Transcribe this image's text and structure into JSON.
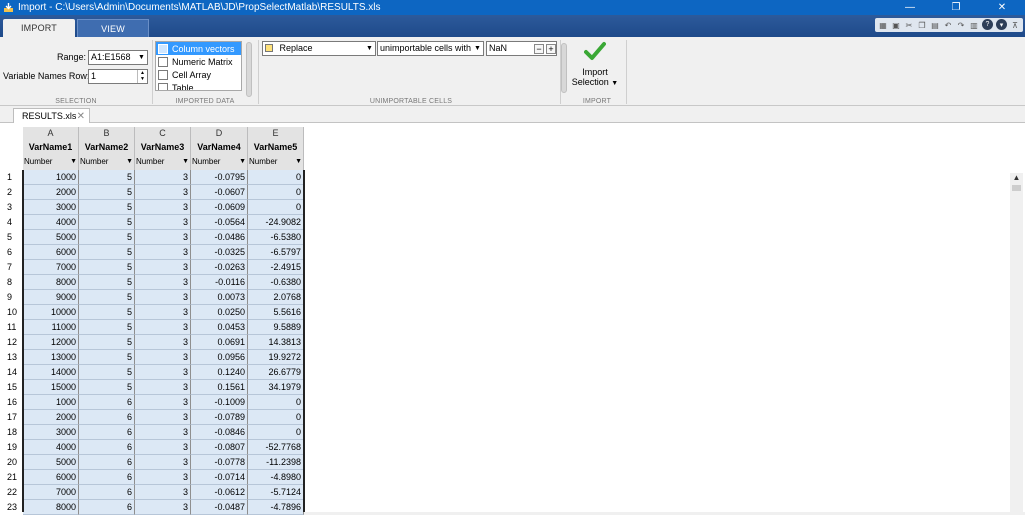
{
  "window": {
    "title": "Import - C:\\Users\\Admin\\Documents\\MATLAB\\JD\\PropSelectMatlab\\RESULTS.xls",
    "minimize": "—",
    "restore": "❐",
    "close": "✕"
  },
  "tabs": [
    {
      "label": "IMPORT",
      "active": true
    },
    {
      "label": "VIEW",
      "active": false
    }
  ],
  "quick_access_icons": [
    "mini-toolstrip-icon",
    "save-icon",
    "cut-icon",
    "copy-icon",
    "paste-icon",
    "undo-icon",
    "redo-icon",
    "switch-windows-icon",
    "help-icon",
    "search-icon",
    "collapse-icon"
  ],
  "selection": {
    "range_label": "Range:",
    "range_value": "A1:E1568",
    "varnames_label": "Variable Names Row:",
    "varnames_value": "1",
    "section_label": "SELECTION"
  },
  "imported_data": {
    "types": [
      {
        "label": "Column vectors",
        "icon": "column-vectors-icon",
        "selected": true
      },
      {
        "label": "Numeric Matrix",
        "icon": "numeric-matrix-icon",
        "selected": false
      },
      {
        "label": "Cell Array",
        "icon": "cell-array-icon",
        "selected": false
      },
      {
        "label": "Table",
        "icon": "table-icon",
        "selected": false
      }
    ],
    "section_label": "IMPORTED DATA"
  },
  "unimportable": {
    "rule": "Replace",
    "condition": "unimportable cells with",
    "value": "NaN",
    "remove": "−",
    "add": "+",
    "section_label": "UNIMPORTABLE CELLS"
  },
  "import": {
    "button_line1": "Import",
    "button_line2": "Selection",
    "section_label": "IMPORT"
  },
  "document_tab": {
    "label": "RESULTS.xls",
    "close": "✕"
  },
  "columns": [
    {
      "letter": "A",
      "name": "VarName1",
      "type": "Number"
    },
    {
      "letter": "B",
      "name": "VarName2",
      "type": "Number"
    },
    {
      "letter": "C",
      "name": "VarName3",
      "type": "Number"
    },
    {
      "letter": "D",
      "name": "VarName4",
      "type": "Number"
    },
    {
      "letter": "E",
      "name": "VarName5",
      "type": "Number"
    }
  ],
  "rows": [
    {
      "n": "1",
      "cells": [
        "1000",
        "5",
        "3",
        "-0.0795",
        "0"
      ]
    },
    {
      "n": "2",
      "cells": [
        "2000",
        "5",
        "3",
        "-0.0607",
        "0"
      ]
    },
    {
      "n": "3",
      "cells": [
        "3000",
        "5",
        "3",
        "-0.0609",
        "0"
      ]
    },
    {
      "n": "4",
      "cells": [
        "4000",
        "5",
        "3",
        "-0.0564",
        "-24.9082"
      ]
    },
    {
      "n": "5",
      "cells": [
        "5000",
        "5",
        "3",
        "-0.0486",
        "-6.5380"
      ]
    },
    {
      "n": "6",
      "cells": [
        "6000",
        "5",
        "3",
        "-0.0325",
        "-6.5797"
      ]
    },
    {
      "n": "7",
      "cells": [
        "7000",
        "5",
        "3",
        "-0.0263",
        "-2.4915"
      ]
    },
    {
      "n": "8",
      "cells": [
        "8000",
        "5",
        "3",
        "-0.0116",
        "-0.6380"
      ]
    },
    {
      "n": "9",
      "cells": [
        "9000",
        "5",
        "3",
        "0.0073",
        "2.0768"
      ]
    },
    {
      "n": "10",
      "cells": [
        "10000",
        "5",
        "3",
        "0.0250",
        "5.5616"
      ]
    },
    {
      "n": "11",
      "cells": [
        "11000",
        "5",
        "3",
        "0.0453",
        "9.5889"
      ]
    },
    {
      "n": "12",
      "cells": [
        "12000",
        "5",
        "3",
        "0.0691",
        "14.3813"
      ]
    },
    {
      "n": "13",
      "cells": [
        "13000",
        "5",
        "3",
        "0.0956",
        "19.9272"
      ]
    },
    {
      "n": "14",
      "cells": [
        "14000",
        "5",
        "3",
        "0.1240",
        "26.6779"
      ]
    },
    {
      "n": "15",
      "cells": [
        "15000",
        "5",
        "3",
        "0.1561",
        "34.1979"
      ]
    },
    {
      "n": "16",
      "cells": [
        "1000",
        "6",
        "3",
        "-0.1009",
        "0"
      ]
    },
    {
      "n": "17",
      "cells": [
        "2000",
        "6",
        "3",
        "-0.0789",
        "0"
      ]
    },
    {
      "n": "18",
      "cells": [
        "3000",
        "6",
        "3",
        "-0.0846",
        "0"
      ]
    },
    {
      "n": "19",
      "cells": [
        "4000",
        "6",
        "3",
        "-0.0807",
        "-52.7768"
      ]
    },
    {
      "n": "20",
      "cells": [
        "5000",
        "6",
        "3",
        "-0.0778",
        "-11.2398"
      ]
    },
    {
      "n": "21",
      "cells": [
        "6000",
        "6",
        "3",
        "-0.0714",
        "-4.8980"
      ]
    },
    {
      "n": "22",
      "cells": [
        "7000",
        "6",
        "3",
        "-0.0612",
        "-5.7124"
      ]
    },
    {
      "n": "23",
      "cells": [
        "8000",
        "6",
        "3",
        "-0.0487",
        "-4.7896"
      ]
    }
  ]
}
